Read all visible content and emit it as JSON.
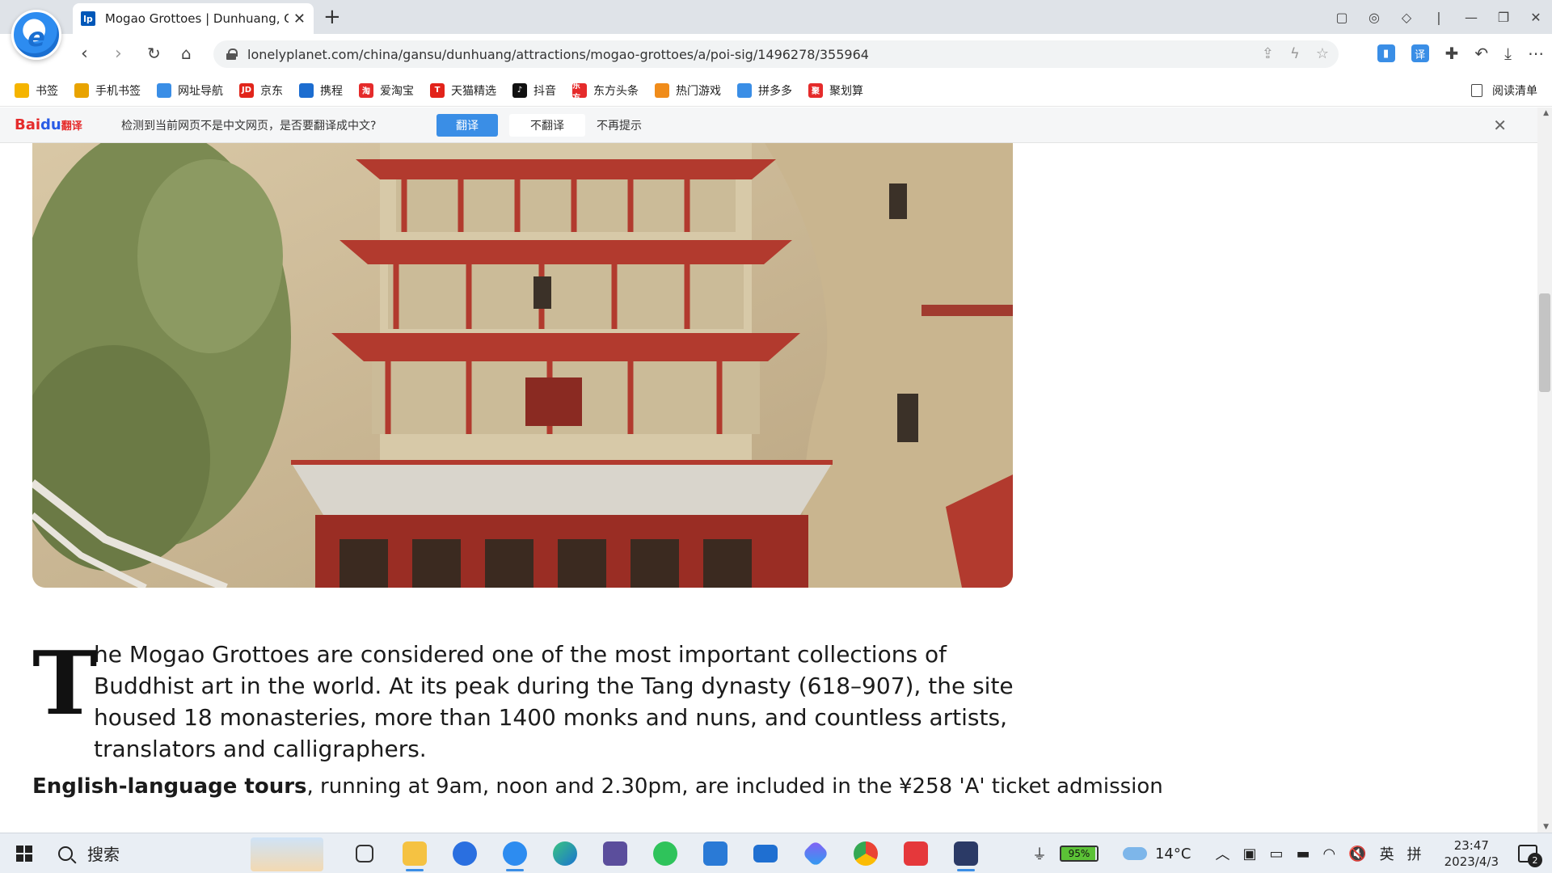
{
  "browser": {
    "tab": {
      "favicon": "lp",
      "title": "Mogao Grottoes | Dunhuang, C"
    },
    "url": "lonelyplanet.com/china/gansu/dunhuang/attractions/mogao-grottoes/a/poi-sig/1496278/355964"
  },
  "bookmarks": [
    {
      "label": "书签",
      "icon": "star-icon",
      "color": "#f5b400"
    },
    {
      "label": "手机书签",
      "icon": "phone-bookmark-icon",
      "color": "#e8a300"
    },
    {
      "label": "网址导航",
      "icon": "nav-icon",
      "color": "#3a8ee6"
    },
    {
      "label": "京东",
      "icon": "jd-icon",
      "color": "#e1251b",
      "glyph": "JD"
    },
    {
      "label": "携程",
      "icon": "ctrip-icon",
      "color": "#1c6dd0"
    },
    {
      "label": "爱淘宝",
      "icon": "taobao-icon",
      "color": "#e52b2b",
      "glyph": "淘"
    },
    {
      "label": "天猫精选",
      "icon": "tmall-icon",
      "color": "#e2231a",
      "glyph": "T"
    },
    {
      "label": "抖音",
      "icon": "douyin-icon",
      "color": "#111111",
      "glyph": "♪"
    },
    {
      "label": "东方头条",
      "icon": "toutiao-icon",
      "color": "#e52b2b",
      "glyph": "东方"
    },
    {
      "label": "热门游戏",
      "icon": "games-icon",
      "color": "#f08c1a"
    },
    {
      "label": "拼多多",
      "icon": "pdd-icon",
      "color": "#3a8ee6"
    },
    {
      "label": "聚划算",
      "icon": "juhuasuan-icon",
      "color": "#e52b2b",
      "glyph": "聚"
    }
  ],
  "reading_list": "阅读清单",
  "translate_bar": {
    "logo_brand": "Bai",
    "logo_paw": "du",
    "logo_suffix": "翻译",
    "message": "检测到当前网页不是中文网页，是否要翻译成中文?",
    "translate_label": "翻译",
    "no_translate_label": "不翻译",
    "never_label": "不再提示"
  },
  "article": {
    "dropcap": "T",
    "para1": "he Mogao Grottoes are considered one of the most important collections of Buddhist art in the world. At its peak during the Tang dynasty (618–907), the site housed 18 monasteries, more than 1400 monks and nuns, and countless artists, translators and calligraphers.",
    "para2_bold": "English-language tours",
    "para2_rest": ", running at 9am, noon and 2.30pm, are included in the ¥258 'A' ticket admission"
  },
  "taskbar": {
    "search_placeholder": "搜索",
    "battery": "95%",
    "weather": "14°C",
    "ime_lang": "英",
    "ime_mode": "拼",
    "time": "23:47",
    "date": "2023/4/3",
    "notifications": "2"
  }
}
